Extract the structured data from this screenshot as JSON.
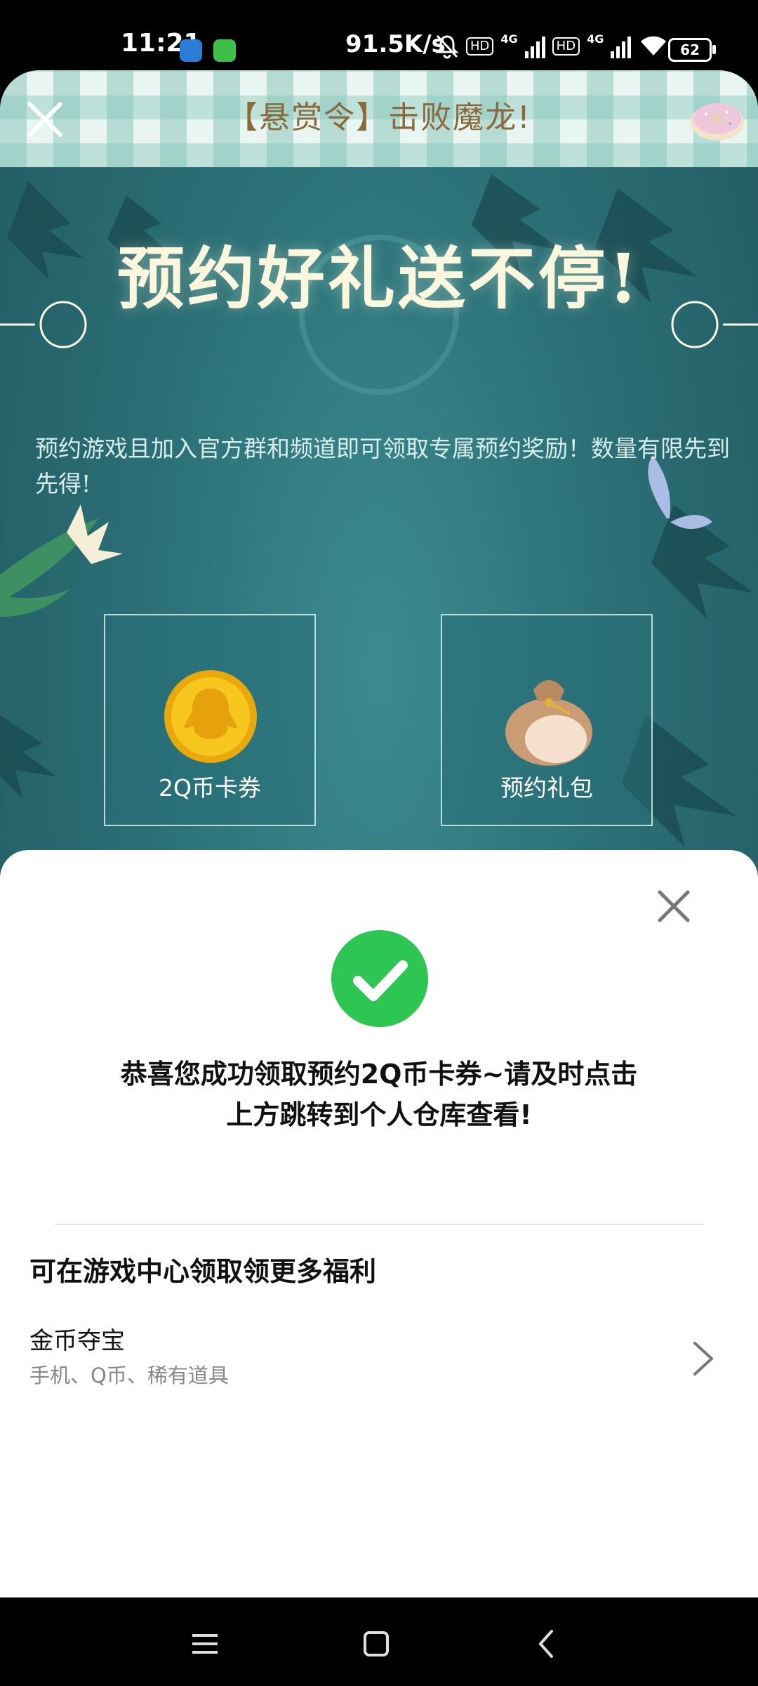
{
  "status_bar": {
    "time": "11:21",
    "net_speed": "91.5K/s",
    "hd1": "HD",
    "net1": "4G",
    "hd2": "HD",
    "net2": "4G",
    "battery": "62"
  },
  "titlebar": {
    "title": "【悬赏令】击败魔龙!",
    "close_icon": "close-icon",
    "menu_icon": "donut-icon"
  },
  "banner": {
    "headline": "预约好礼送不停!",
    "subline": "预约游戏且加入官方群和频道即可领取专属预约奖励！数量有限先到先得!",
    "prizes": [
      {
        "label": "2Q币卡券",
        "icon": "q-coin-icon"
      },
      {
        "label": "预约礼包",
        "icon": "gift-bag-icon"
      }
    ]
  },
  "sheet": {
    "success_message": "恭喜您成功领取预约2Q币卡券~请及时点击上方跳转到个人仓库查看!",
    "section_title": "可在游戏中心领取领更多福利",
    "row": {
      "title": "金币夺宝",
      "subtitle": "手机、Q币、稀有道具"
    }
  },
  "colors": {
    "success_green": "#2dc653",
    "banner_teal": "#2d6c73",
    "title_brown": "#8a6a3a"
  }
}
